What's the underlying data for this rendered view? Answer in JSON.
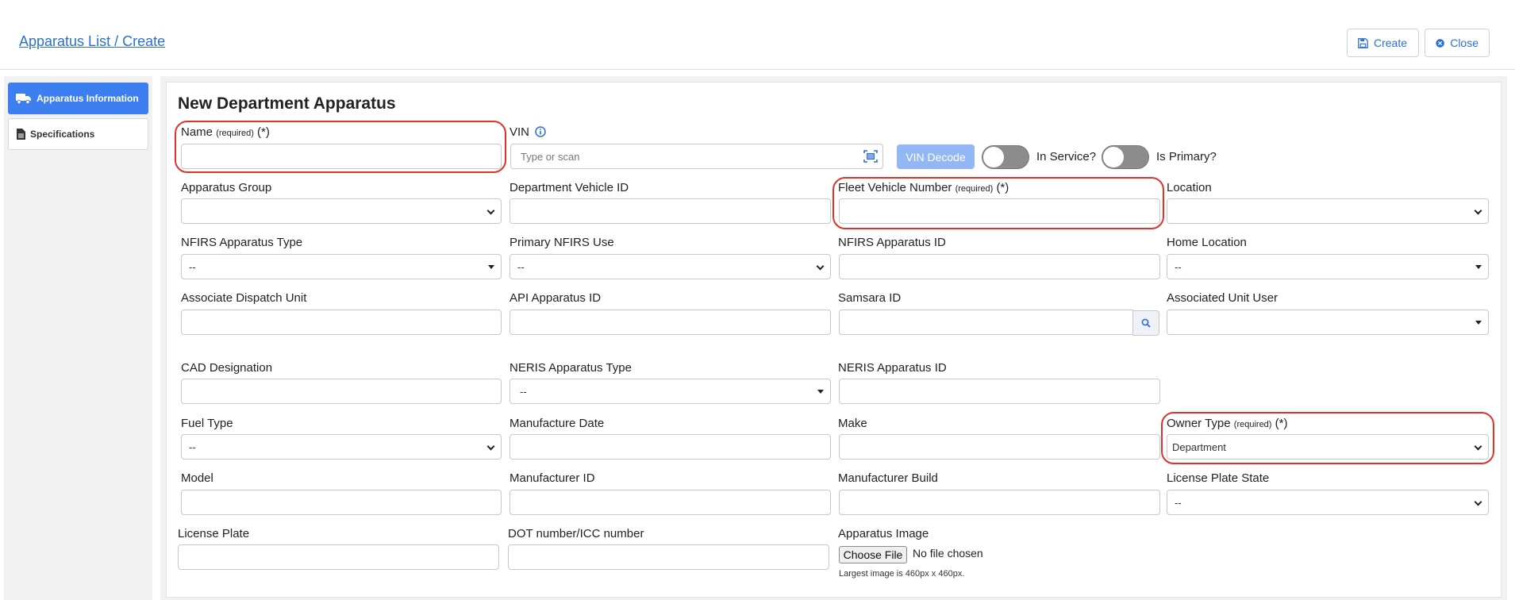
{
  "header": {
    "breadcrumb": "Apparatus List / Create",
    "create_label": "Create",
    "close_label": "Close"
  },
  "sidebar": {
    "items": [
      {
        "label": "Apparatus Information",
        "icon": "truck-icon",
        "active": true
      },
      {
        "label": "Specifications",
        "icon": "document-icon",
        "active": false
      }
    ]
  },
  "form": {
    "title": "New Department Apparatus",
    "required_marker": "(required)",
    "required_star": "(*)",
    "name_label": "Name",
    "vin_label": "VIN",
    "vin_placeholder": "Type or scan",
    "vin_decode_label": "VIN Decode",
    "in_service_label": "In Service?",
    "is_primary_label": "Is Primary?",
    "apparatus_group_label": "Apparatus Group",
    "department_vehicle_id_label": "Department Vehicle ID",
    "fleet_vehicle_number_label": "Fleet Vehicle Number",
    "location_label": "Location",
    "nfirs_apparatus_type_label": "NFIRS Apparatus Type",
    "nfirs_apparatus_type_value": "--",
    "primary_nfirs_use_label": "Primary NFIRS Use",
    "primary_nfirs_use_value": "--",
    "nfirs_apparatus_id_label": "NFIRS Apparatus ID",
    "home_location_label": "Home Location",
    "home_location_value": "--",
    "associate_dispatch_unit_label": "Associate Dispatch Unit",
    "api_apparatus_id_label": "API Apparatus ID",
    "samsara_id_label": "Samsara ID",
    "associated_unit_user_label": "Associated Unit User",
    "cad_designation_label": "CAD Designation",
    "neris_apparatus_type_label": "NERIS Apparatus Type",
    "neris_apparatus_type_value": "--",
    "neris_apparatus_id_label": "NERIS Apparatus ID",
    "fuel_type_label": "Fuel Type",
    "fuel_type_value": "--",
    "manufacture_date_label": "Manufacture Date",
    "make_label": "Make",
    "owner_type_label": "Owner Type",
    "owner_type_value": "Department",
    "model_label": "Model",
    "manufacturer_id_label": "Manufacturer ID",
    "manufacturer_build_label": "Manufacturer Build",
    "license_plate_state_label": "License Plate State",
    "license_plate_state_value": "--",
    "license_plate_label": "License Plate",
    "dot_icc_label": "DOT number/ICC number",
    "apparatus_image_label": "Apparatus Image",
    "choose_file_label": "Choose File",
    "no_file_label": "No file chosen",
    "image_hint": "Largest image is 460px x 460px."
  },
  "colors": {
    "accent": "#3d7ef0",
    "link": "#2a6fd6",
    "annotation": "#e0322a"
  }
}
